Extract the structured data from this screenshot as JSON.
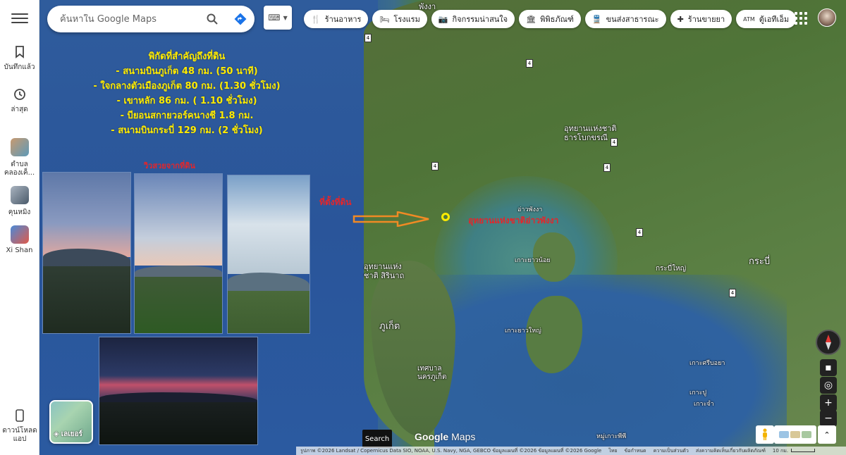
{
  "sidebar": {
    "items": [
      {
        "label": "บันทึกแล้ว",
        "icon": "bookmark-icon"
      },
      {
        "label": "ล่าสุด",
        "icon": "history-icon"
      },
      {
        "label": "ตำบล คลองเค็...",
        "icon": "place-thumb-icon"
      },
      {
        "label": "คุนหมิง",
        "icon": "place-thumb-icon"
      },
      {
        "label": "Xi Shan",
        "icon": "place-thumb-icon"
      }
    ],
    "download_label": "ดาวน์โหลดแอป"
  },
  "search": {
    "placeholder": "ค้นหาใน Google Maps"
  },
  "chips": [
    {
      "label": "ร้านอาหาร",
      "icon": "restaurant-icon"
    },
    {
      "label": "โรงแรม",
      "icon": "hotel-icon"
    },
    {
      "label": "กิจกรรมน่าสนใจ",
      "icon": "camera-icon"
    },
    {
      "label": "พิพิธภัณฑ์",
      "icon": "museum-icon"
    },
    {
      "label": "ขนส่งสาธารณะ",
      "icon": "transit-icon"
    },
    {
      "label": "ร้านขายยา",
      "icon": "pharmacy-icon"
    },
    {
      "label": "ตู้เอทีเอ็ม",
      "icon": "atm-icon"
    }
  ],
  "overlay": {
    "info_lines": [
      "พิกัดที่สำคัญถึงที่ดิน",
      "- สนามบินภูเก็ต 48 กม. (50 นาที)",
      "- ใจกลางตัวเมืองภูเก็ต 80 กม. (1.30 ชั่วโมง)",
      "- เขาหลัก 86 กม. ( 1.10 ชั่วโมง)",
      "- บียอนสกายวอร์คนางชี 1.8 กม.",
      "- สนามบินกระบี่ 129 กม. (2 ชั่วโมง)"
    ],
    "photo_caption": "วิวสวยจากที่ดิน",
    "land_caption": "ที่ตั้งที่ดิน",
    "park_caption": "อุทยานแห่งชาติอ่าวพังงา"
  },
  "map_labels": {
    "phang_nga": "พังงา",
    "park_thanbok": "อุทยานแห่งชาติ ธารโบกขรณี",
    "ao_phang_nga": "อ่าวพังงา",
    "park_sirinat": "อุทยานแห่งชาติ สิรินาถ",
    "ko_yao_noi": "เกาะยาวน้อย",
    "ko_yao_yai": "เกาะยาวใหญ่",
    "phuket": "ภูเก็ต",
    "phuket_city": "เทศบาล นครภูเก็ต",
    "krabi": "กระบี่",
    "krabi_yai": "กระบี่ใหญ่",
    "ko_si_boya": "เกาะศรีบอยา",
    "ko_pu": "เกาะปู",
    "ko_chum": "เกาะจำ",
    "ko_phi_phi": "หมู่เกาะพีพี"
  },
  "controls": {
    "layers_label": "เลเยอร์",
    "search_area": "Search",
    "logo_google": "Google",
    "logo_maps": "Maps"
  },
  "footer": {
    "attribution": "รูปภาพ ©2026 Landsat / Copernicus Data SIO, NOAA, U.S. Navy, NGA, GEBCO ข้อมูลแผนที่ ©2026 ข้อมูลแผนที่ ©2026 Google",
    "thai": "ไทย",
    "terms": "ข้อกำหนด",
    "privacy": "ความเป็นส่วนตัว",
    "feedback": "ส่งความคิดเห็นเกี่ยวกับผลิตภัณฑ์",
    "scale": "10 กม."
  },
  "colors": {
    "overlay_text": "#ffeb00",
    "caption_red": "#e3262b",
    "marker": "#ffeb00",
    "arrow": "#f08a24"
  }
}
